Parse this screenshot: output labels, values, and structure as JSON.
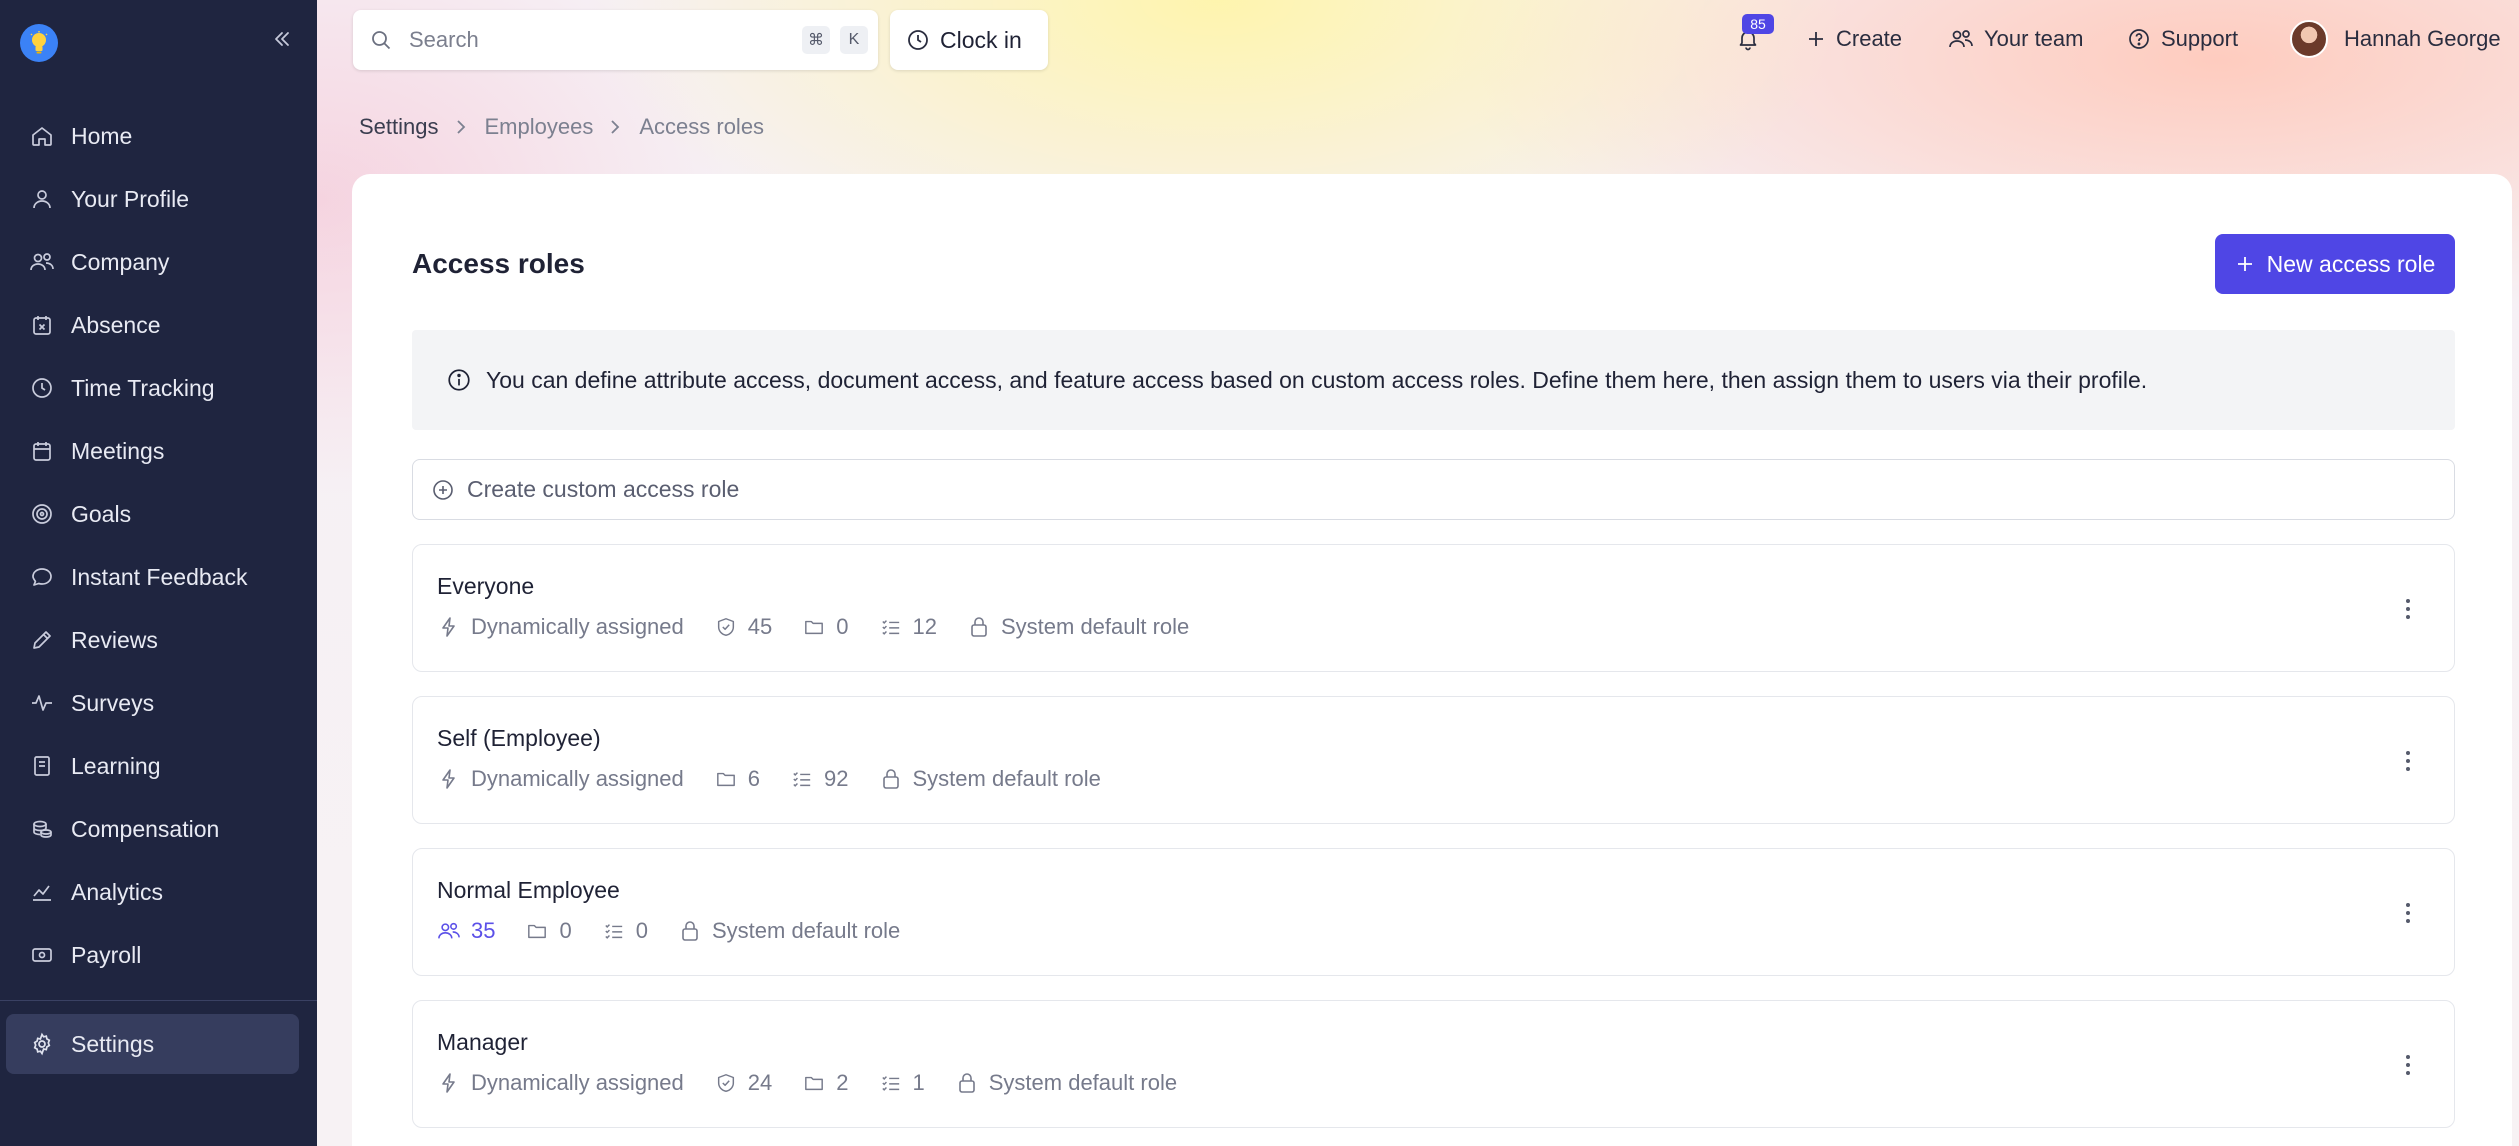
{
  "sidebar": {
    "logo_icon": "lightbulb-icon",
    "collapse_icon": "chevrons-left-icon",
    "items": [
      {
        "label": "Home",
        "icon": "home-icon"
      },
      {
        "label": "Your Profile",
        "icon": "user-icon"
      },
      {
        "label": "Company",
        "icon": "users-icon"
      },
      {
        "label": "Absence",
        "icon": "calendar-x-icon"
      },
      {
        "label": "Time Tracking",
        "icon": "clock-icon"
      },
      {
        "label": "Meetings",
        "icon": "calendar-icon"
      },
      {
        "label": "Goals",
        "icon": "target-icon"
      },
      {
        "label": "Instant Feedback",
        "icon": "message-icon"
      },
      {
        "label": "Reviews",
        "icon": "pen-icon"
      },
      {
        "label": "Surveys",
        "icon": "pulse-icon"
      },
      {
        "label": "Learning",
        "icon": "book-icon"
      },
      {
        "label": "Compensation",
        "icon": "coins-icon"
      },
      {
        "label": "Analytics",
        "icon": "chart-icon"
      },
      {
        "label": "Payroll",
        "icon": "banknote-icon"
      },
      {
        "label": "Settings",
        "icon": "gear-icon",
        "active": true
      }
    ]
  },
  "topbar": {
    "search_placeholder": "Search",
    "shortcut_keys": [
      "⌘",
      "K"
    ],
    "clock_in_label": "Clock in",
    "notifications_count": "85",
    "create_label": "Create",
    "team_label": "Your team",
    "support_label": "Support",
    "user_name": "Hannah George"
  },
  "breadcrumb": [
    "Settings",
    "Employees",
    "Access roles"
  ],
  "page": {
    "title": "Access roles",
    "new_button_label": "New access role",
    "info_text": "You can define attribute access, document access, and feature access based on custom access roles. Define them here, then assign them to users via their profile.",
    "create_custom_label": "Create custom access role"
  },
  "roles": [
    {
      "name": "Everyone",
      "meta": [
        {
          "icon": "bolt-icon",
          "text": "Dynamically assigned"
        },
        {
          "icon": "shield-check-icon",
          "text": "45"
        },
        {
          "icon": "folder-icon",
          "text": "0"
        },
        {
          "icon": "checklist-icon",
          "text": "12"
        },
        {
          "icon": "lock-icon",
          "text": "System default role"
        }
      ]
    },
    {
      "name": "Self (Employee)",
      "meta": [
        {
          "icon": "bolt-icon",
          "text": "Dynamically assigned"
        },
        {
          "icon": "folder-icon",
          "text": "6"
        },
        {
          "icon": "checklist-icon",
          "text": "92"
        },
        {
          "icon": "lock-icon",
          "text": "System default role"
        }
      ]
    },
    {
      "name": "Normal Employee",
      "meta": [
        {
          "icon": "users-icon",
          "text": "35",
          "accent": true
        },
        {
          "icon": "folder-icon",
          "text": "0"
        },
        {
          "icon": "checklist-icon",
          "text": "0"
        },
        {
          "icon": "lock-icon",
          "text": "System default role"
        }
      ]
    },
    {
      "name": "Manager",
      "meta": [
        {
          "icon": "bolt-icon",
          "text": "Dynamically assigned"
        },
        {
          "icon": "shield-check-icon",
          "text": "24"
        },
        {
          "icon": "folder-icon",
          "text": "2"
        },
        {
          "icon": "checklist-icon",
          "text": "1"
        },
        {
          "icon": "lock-icon",
          "text": "System default role"
        }
      ]
    }
  ],
  "colors": {
    "sidebar_bg": "#1f2540",
    "accent": "#4f46e5"
  }
}
